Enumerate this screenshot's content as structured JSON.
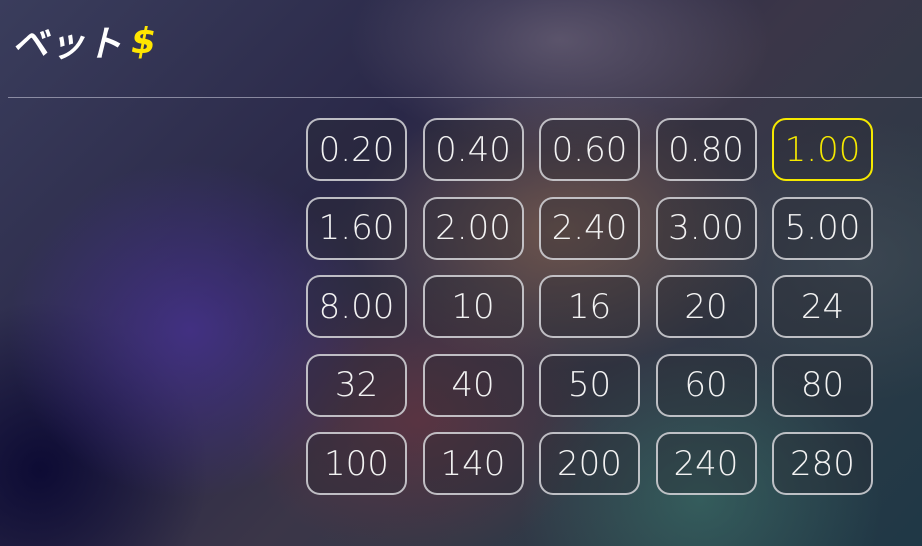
{
  "header": {
    "title": "ベット",
    "currency_symbol": "$"
  },
  "colors": {
    "selected_accent": "#f5e900",
    "button_border": "#d7d7dc",
    "text": "#f2f2f2"
  },
  "bet_options": [
    {
      "label": "0.20",
      "selected": false
    },
    {
      "label": "0.40",
      "selected": false
    },
    {
      "label": "0.60",
      "selected": false
    },
    {
      "label": "0.80",
      "selected": false
    },
    {
      "label": "1.00",
      "selected": true
    },
    {
      "label": "1.60",
      "selected": false
    },
    {
      "label": "2.00",
      "selected": false
    },
    {
      "label": "2.40",
      "selected": false
    },
    {
      "label": "3.00",
      "selected": false
    },
    {
      "label": "5.00",
      "selected": false
    },
    {
      "label": "8.00",
      "selected": false
    },
    {
      "label": "10",
      "selected": false
    },
    {
      "label": "16",
      "selected": false
    },
    {
      "label": "20",
      "selected": false
    },
    {
      "label": "24",
      "selected": false
    },
    {
      "label": "32",
      "selected": false
    },
    {
      "label": "40",
      "selected": false
    },
    {
      "label": "50",
      "selected": false
    },
    {
      "label": "60",
      "selected": false
    },
    {
      "label": "80",
      "selected": false
    },
    {
      "label": "100",
      "selected": false
    },
    {
      "label": "140",
      "selected": false
    },
    {
      "label": "200",
      "selected": false
    },
    {
      "label": "240",
      "selected": false
    },
    {
      "label": "280",
      "selected": false
    }
  ]
}
